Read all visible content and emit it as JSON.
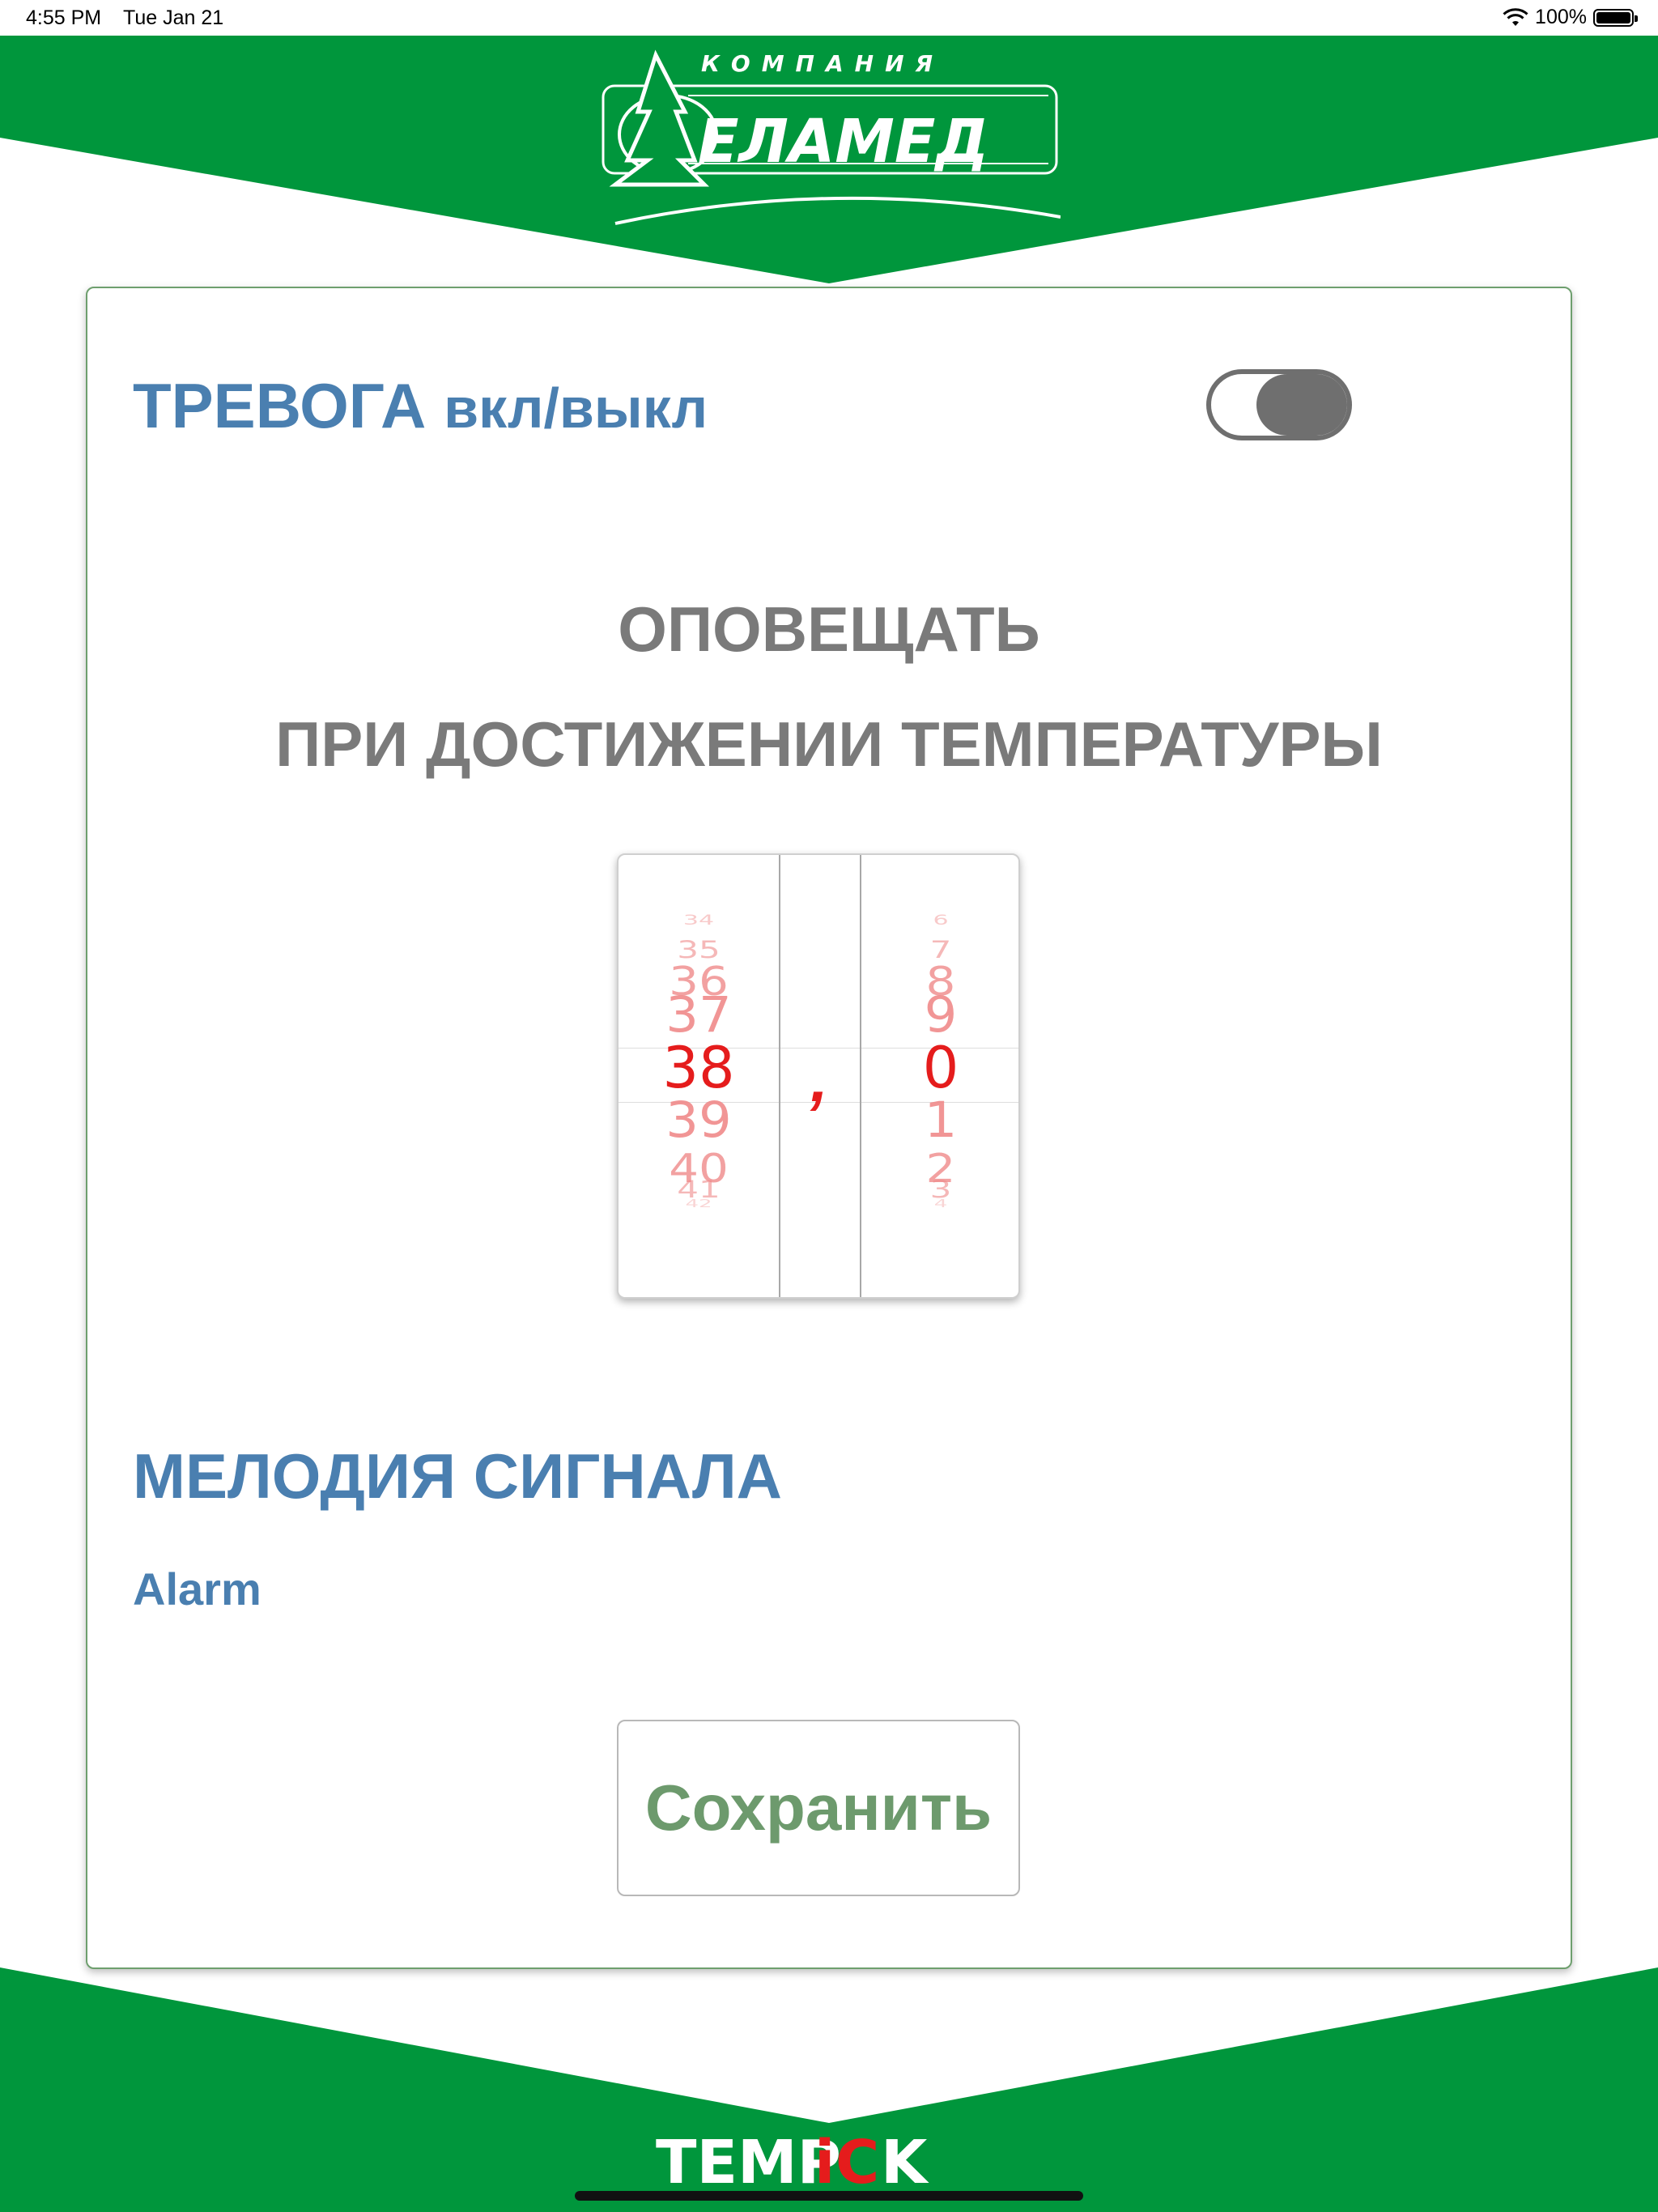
{
  "status_bar": {
    "time": "4:55 PM",
    "date": "Tue Jan 21",
    "battery": "100%",
    "battery_level": 1.0
  },
  "brand": {
    "company_caption": "КОМПАНИЯ",
    "company_name": "ЕЛАМЕД",
    "footer_logo": "TEMPiCK",
    "green": "#00963c",
    "accent_red": "#e51c1c"
  },
  "alarm": {
    "title_main": "ТРЕВОГА",
    "title_sub": "вкл/выкл",
    "enabled": true
  },
  "notify": {
    "line1": "ОПОВЕЩАТЬ",
    "line2": "ПРИ ДОСТИЖЕНИИ ТЕМПЕРАТУРЫ"
  },
  "picker": {
    "integers": [
      "34",
      "35",
      "36",
      "37",
      "38",
      "39",
      "40",
      "41",
      "42"
    ],
    "selected_integer": "38",
    "separator": ",",
    "decimals": [
      "6",
      "7",
      "8",
      "9",
      "0",
      "1",
      "2",
      "3",
      "4"
    ],
    "selected_decimal": "0"
  },
  "melody": {
    "title": "МЕЛОДИЯ СИГНАЛА",
    "value": "Alarm"
  },
  "save_label": "Сохранить"
}
